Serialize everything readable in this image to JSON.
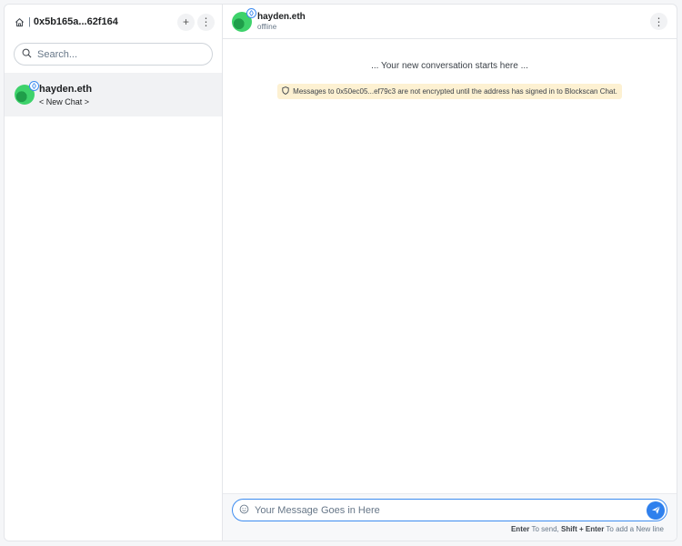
{
  "sidebar": {
    "address": "0x5b165a...62f164",
    "separator": "|",
    "add_label": "+",
    "menu_label": "⋮",
    "search_placeholder": "Search...",
    "chats": [
      {
        "name": "hayden.eth",
        "subtitle": "< New Chat >"
      }
    ]
  },
  "header": {
    "peer_name": "hayden.eth",
    "peer_status": "offline",
    "menu_label": "⋮"
  },
  "conversation": {
    "start_note": "... Your new conversation starts here ...",
    "warning": "Messages to 0x50ec05...ef79c3 are not encrypted until the address has signed in to Blockscan Chat."
  },
  "composer": {
    "placeholder": "Your Message Goes in Here",
    "hint_enter": "Enter",
    "hint_send": "To send,",
    "hint_shift": "Shift + Enter",
    "hint_newline": "To add a New line"
  },
  "colors": {
    "accent": "#2f80ed",
    "warning_bg": "#fdf1d2",
    "avatar_green": "#3ed26b"
  }
}
